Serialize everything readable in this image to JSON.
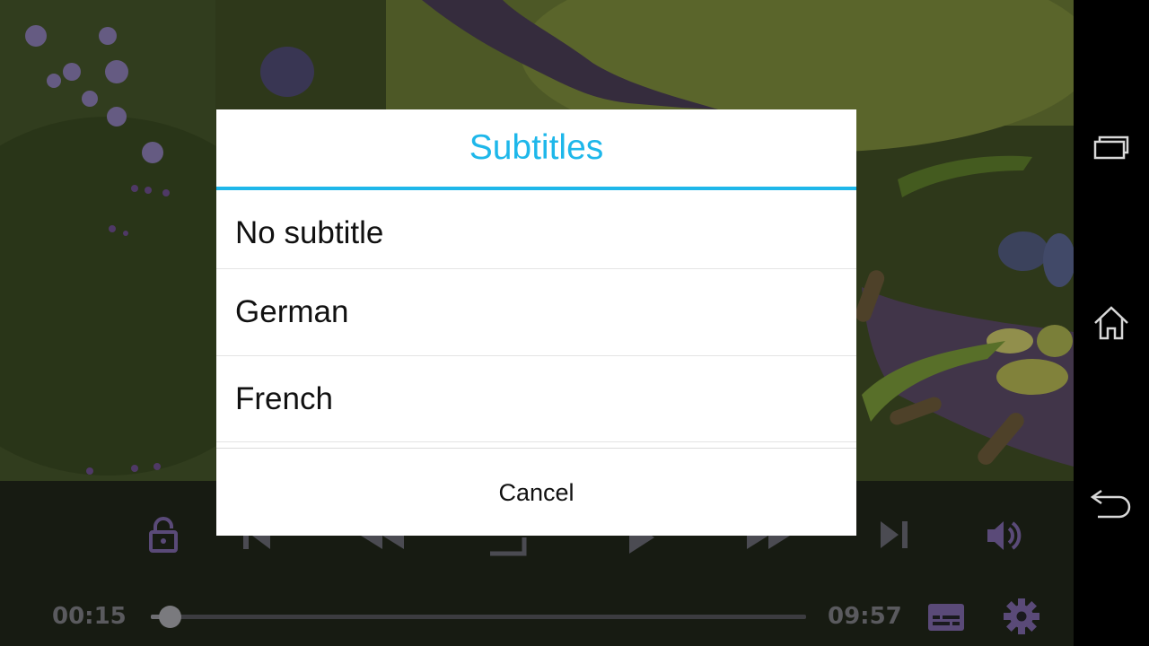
{
  "dialog": {
    "title": "Subtitles",
    "options": [
      "No subtitle",
      "German",
      "French"
    ],
    "cancel_label": "Cancel"
  },
  "player": {
    "elapsed": "00:15",
    "duration": "09:57",
    "progress_fraction": 0.025
  },
  "icons": {
    "lock": "lock-icon",
    "previous": "skip-previous-icon",
    "rewind": "rewind-icon",
    "aspect": "aspect-ratio-icon",
    "play": "play-icon",
    "forward": "fast-forward-icon",
    "next": "skip-next-icon",
    "volume": "volume-icon",
    "subtitles": "subtitles-icon",
    "settings": "gear-icon",
    "recents": "recent-apps-icon",
    "home": "home-icon",
    "back": "back-icon"
  },
  "colors": {
    "accent": "#1eb7ea",
    "control_icon": "#5a4a78",
    "nav_icon": "#d8d8d8"
  }
}
